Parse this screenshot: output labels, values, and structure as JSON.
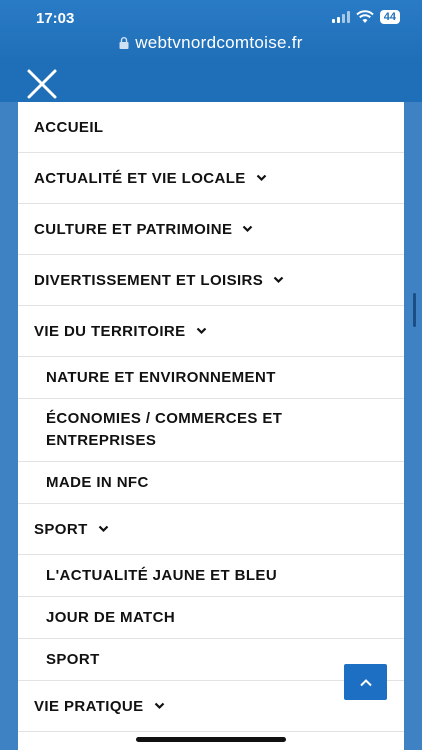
{
  "status_bar": {
    "time": "17:03",
    "battery": "44"
  },
  "browser": {
    "url": "webtvnordcomtoise.fr"
  },
  "menu": {
    "items": [
      {
        "label": "ACCUEIL",
        "level": 1,
        "has_submenu": false
      },
      {
        "label": "ACTUALITÉ ET VIE LOCALE",
        "level": 1,
        "has_submenu": true
      },
      {
        "label": "CULTURE ET PATRIMOINE",
        "level": 1,
        "has_submenu": true
      },
      {
        "label": "DIVERTISSEMENT ET LOISIRS",
        "level": 1,
        "has_submenu": true
      },
      {
        "label": "VIE DU TERRITOIRE",
        "level": 1,
        "has_submenu": true
      },
      {
        "label": "NATURE ET ENVIRONNEMENT",
        "level": 2,
        "has_submenu": false
      },
      {
        "label": "ÉCONOMIES / COMMERCES ET ENTREPRISES",
        "level": 2,
        "has_submenu": false
      },
      {
        "label": "MADE IN NFC",
        "level": 2,
        "has_submenu": false
      },
      {
        "label": "SPORT",
        "level": 1,
        "has_submenu": true
      },
      {
        "label": "L'ACTUALITÉ JAUNE ET BLEU",
        "level": 2,
        "has_submenu": false
      },
      {
        "label": "JOUR DE MATCH",
        "level": 2,
        "has_submenu": false
      },
      {
        "label": "SPORT",
        "level": 2,
        "has_submenu": false
      },
      {
        "label": "VIE PRATIQUE",
        "level": 1,
        "has_submenu": true
      }
    ]
  },
  "icons": {
    "close": "close-icon",
    "chevron": "chevron-down-icon",
    "scroll_top": "chevron-up-icon",
    "lock": "lock-icon"
  },
  "colors": {
    "brand_blue": "#1f6fb8",
    "menu_bg": "#ffffff",
    "button_blue": "#1c6fc3"
  }
}
